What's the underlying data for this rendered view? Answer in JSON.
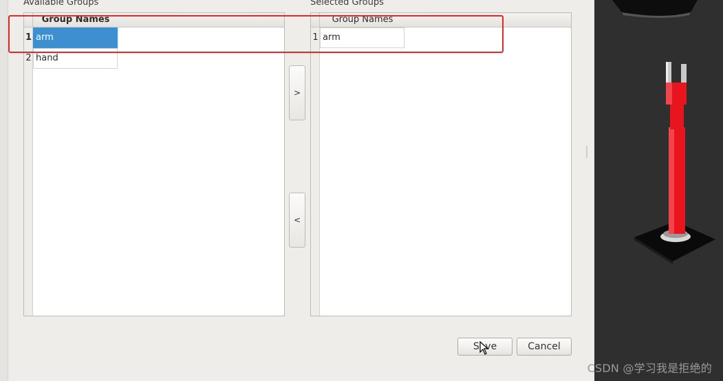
{
  "available_groups": {
    "title": "Available Groups",
    "column_header": "Group Names",
    "rows": [
      {
        "index": "1",
        "name": "arm",
        "selected": true
      },
      {
        "index": "2",
        "name": "hand",
        "selected": false
      }
    ]
  },
  "selected_groups": {
    "title": "Selected Groups",
    "column_header": "Group Names",
    "rows": [
      {
        "index": "1",
        "name": "arm"
      }
    ]
  },
  "buttons": {
    "add_label": ">",
    "remove_label": "<",
    "save_label": "Save",
    "cancel_label": "Cancel"
  },
  "watermark": "CSDN @学习我是拒绝的",
  "colors": {
    "selection": "#3d8fcf",
    "highlight": "#e02828",
    "robot": "#e8141e",
    "viewport_bg": "#2f2f2f"
  }
}
